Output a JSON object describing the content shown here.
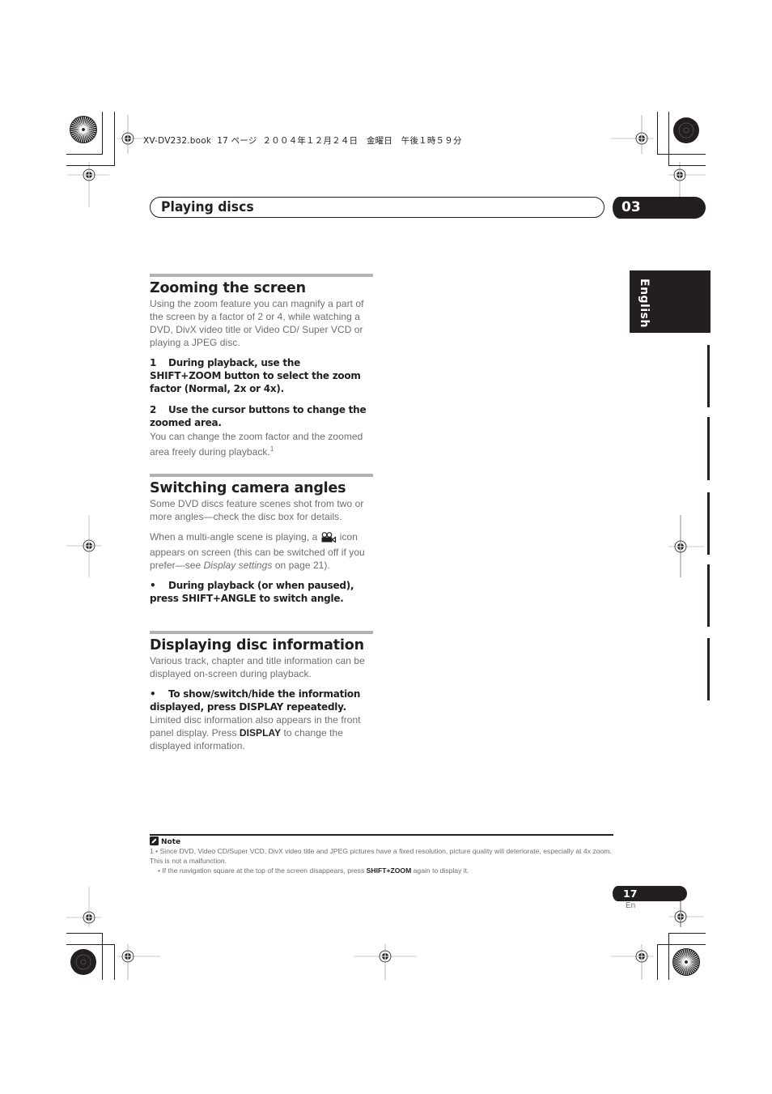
{
  "header": {
    "file_info": "XV-DV232.book  17 ページ  ２００４年１２月２４日　金曜日　午後１時５９分",
    "chapter_title": "Playing discs",
    "chapter_number": "03",
    "language_tab": "English"
  },
  "sections": [
    {
      "title": "Zooming the screen",
      "intro": "Using the zoom feature you can magnify a part of the screen by a factor of 2 or 4, while watching a DVD, DivX video title or Video CD/ Super VCD or playing a JPEG disc.",
      "steps": [
        {
          "num": "1",
          "text": "During playback, use the SHIFT+ZOOM button to select the zoom factor (Normal, 2x or 4x)."
        },
        {
          "num": "2",
          "text": "Use the cursor buttons to change the zoomed area."
        }
      ],
      "after": "You can change the zoom factor and the zoomed area freely during playback.",
      "footnote_ref": "1"
    },
    {
      "title": "Switching camera angles",
      "intro": "Some DVD discs feature scenes shot from two or more angles—check the disc box for details.",
      "para2_before_icon": "When a multi-angle scene is playing, a",
      "para2_icon": "camera-angle-icon",
      "para2_after_icon": "icon appears on screen (this can be switched off if you prefer—see",
      "para2_italic": "Display settings",
      "para2_end": "on page 21).",
      "bullet": "During playback (or when paused), press SHIFT+ANGLE to switch angle."
    },
    {
      "title": "Displaying disc information",
      "intro": "Various track, chapter and title information can be displayed on-screen during playback.",
      "bullet": "To show/switch/hide the information displayed, press DISPLAY repeatedly.",
      "after_before_bold": "Limited disc information also appears in the front panel display. Press",
      "after_bold": "DISPLAY",
      "after_end": "to change the displayed information."
    }
  ],
  "notes": {
    "heading": "Note",
    "icon": "note-pencil-icon",
    "line1": "1  • Since DVD, Video CD/Super VCD, DivX video title and JPEG pictures have a fixed resolution, picture quality will deteriorate, especially at 4x zoom. This is not a malfunction.",
    "line2_before_bold": "• If the navigation square at the top of the screen disappears, press",
    "line2_bold": "SHIFT+ZOOM",
    "line2_end": "again to display it."
  },
  "footer": {
    "page_number": "17",
    "page_lang": "En"
  },
  "bullet_symbol": "•"
}
